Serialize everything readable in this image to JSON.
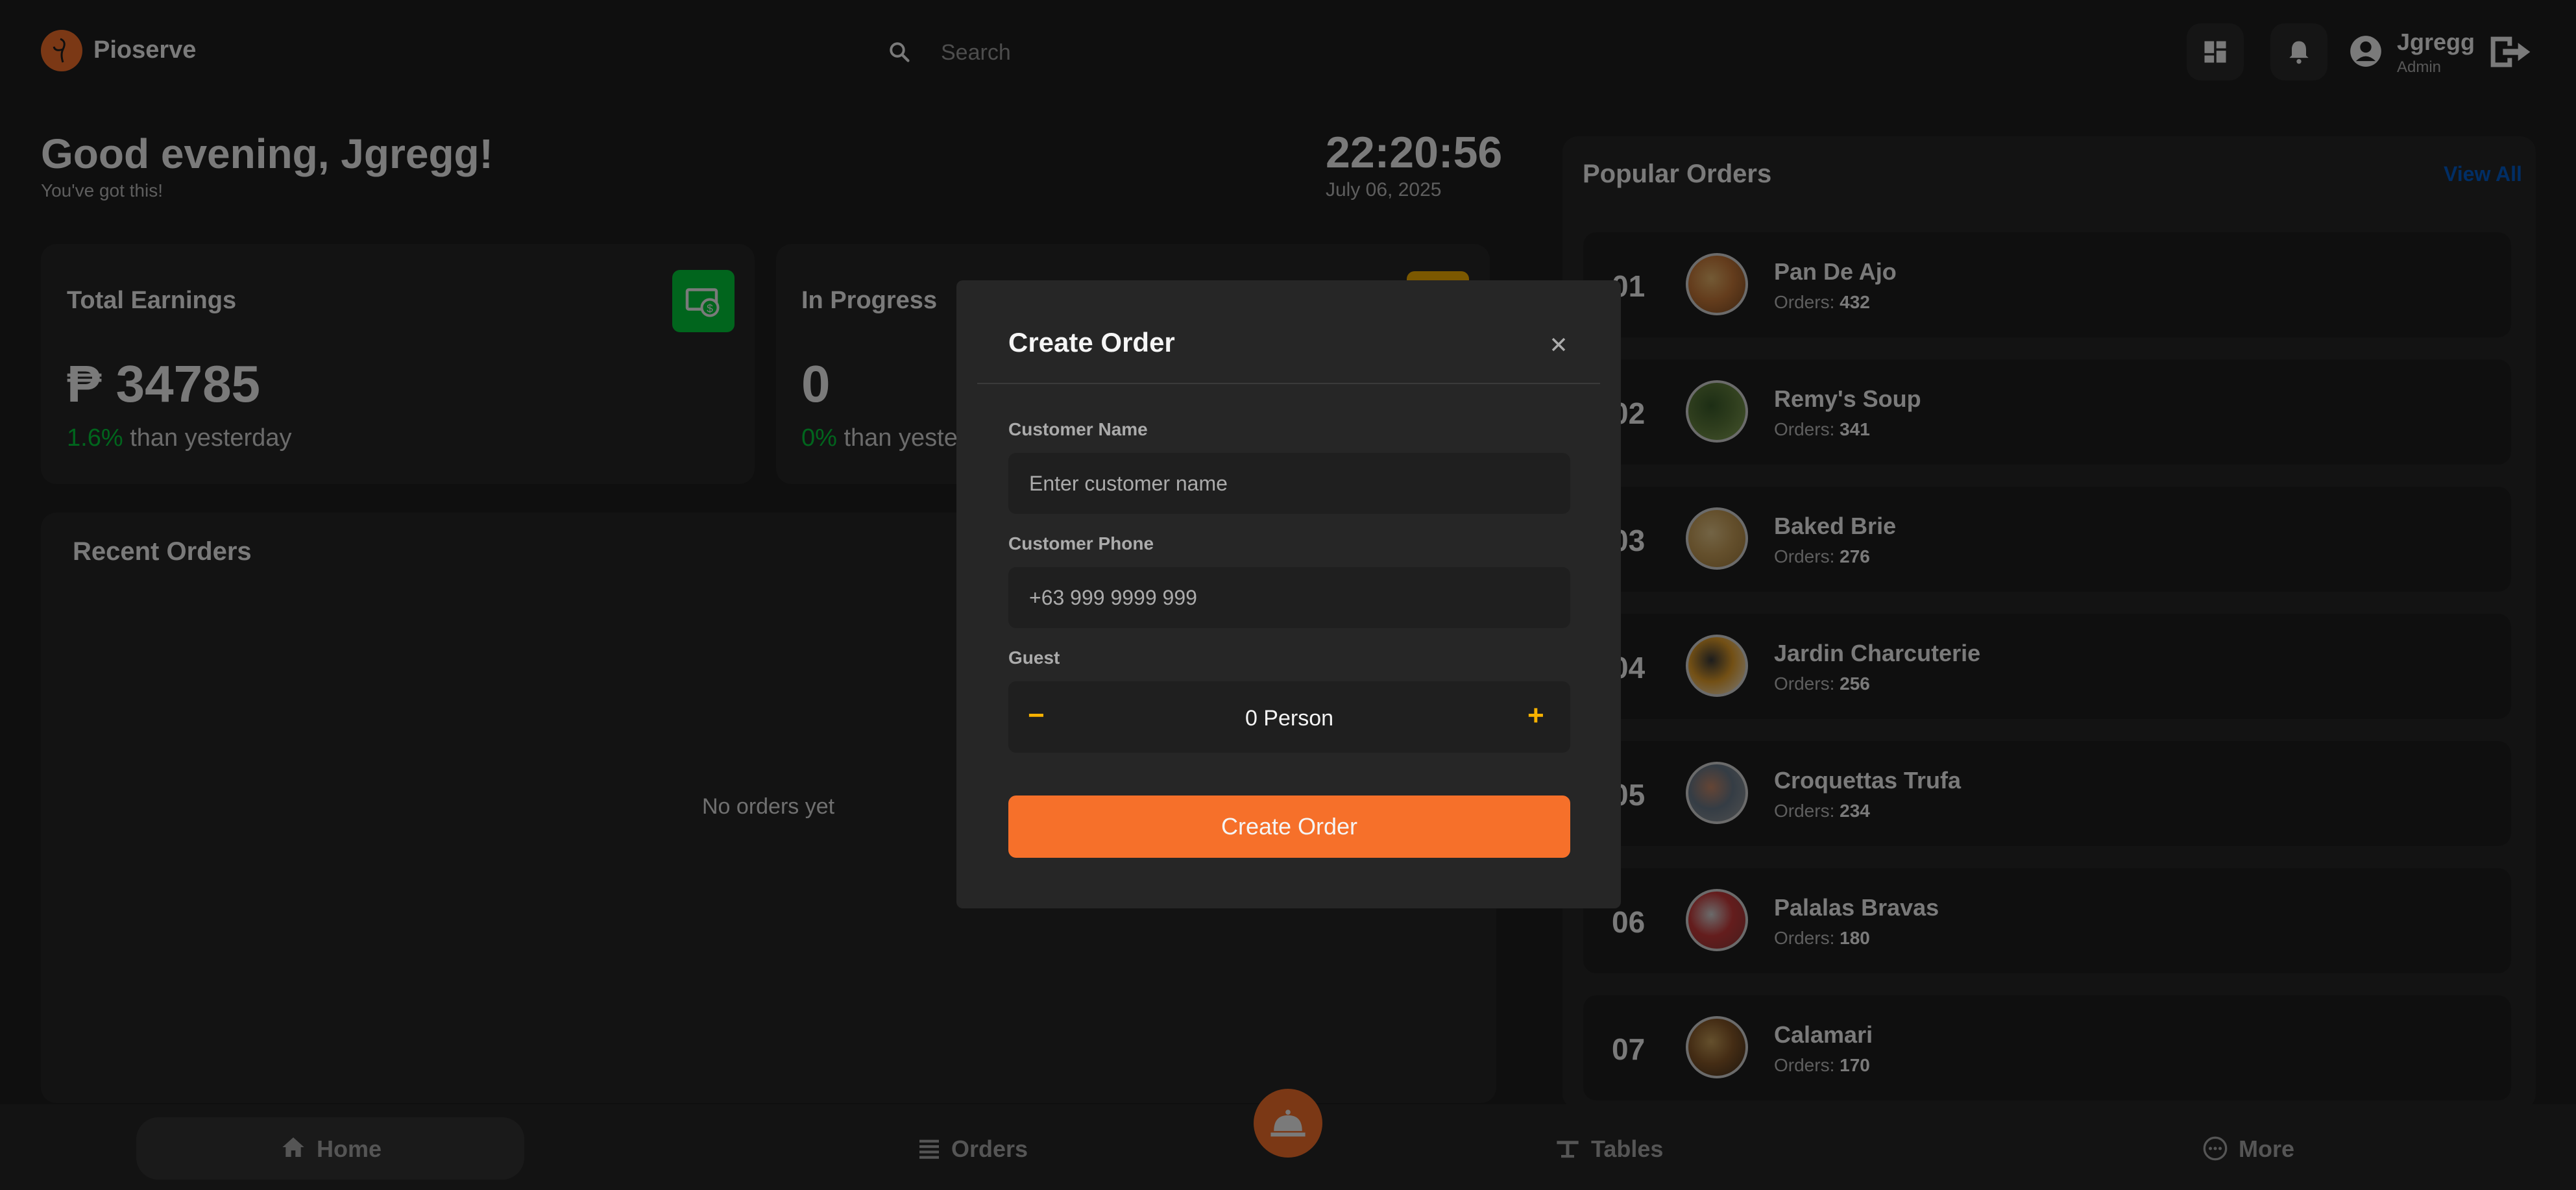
{
  "app": {
    "name": "Pioserve"
  },
  "header": {
    "search_placeholder": "Search",
    "user": {
      "name": "Jgregg",
      "role": "Admin"
    }
  },
  "greeting": {
    "title": "Good evening, Jgregg!",
    "subtitle": "You've got this!"
  },
  "clock": {
    "time": "22:20:56",
    "date": "July 06, 2025"
  },
  "stats": [
    {
      "title": "Total Earnings",
      "value": "₱ 34785",
      "delta": "1.6%",
      "delta_text": "than yesterday"
    },
    {
      "title": "In Progress",
      "value": "0",
      "delta": "0%",
      "delta_text": "than yeste"
    }
  ],
  "recent_orders": {
    "title": "Recent Orders",
    "empty_text": "No orders yet"
  },
  "popular": {
    "title": "Popular Orders",
    "view_all": "View All",
    "orders_label": "Orders:",
    "items": [
      {
        "num": "01",
        "name": "Pan De Ajo",
        "orders": "432"
      },
      {
        "num": "02",
        "name": "Remy's Soup",
        "orders": "341"
      },
      {
        "num": "03",
        "name": "Baked Brie",
        "orders": "276"
      },
      {
        "num": "04",
        "name": "Jardin Charcuterie",
        "orders": "256"
      },
      {
        "num": "05",
        "name": "Croquettas Trufa",
        "orders": "234"
      },
      {
        "num": "06",
        "name": "Palalas Bravas",
        "orders": "180"
      },
      {
        "num": "07",
        "name": "Calamari",
        "orders": "170"
      }
    ]
  },
  "nav": {
    "home": "Home",
    "orders": "Orders",
    "tables": "Tables",
    "more": "More"
  },
  "modal": {
    "title": "Create Order",
    "customer_name_label": "Customer Name",
    "customer_name_placeholder": "Enter customer name",
    "customer_phone_label": "Customer Phone",
    "customer_phone_placeholder": "+63 999 9999 999",
    "guest_label": "Guest",
    "guest_value": "0 Person",
    "minus": "−",
    "plus": "+",
    "submit_label": "Create Order"
  },
  "colors": {
    "accent": "#f6702a",
    "success": "#02ca3a",
    "warning": "#f6b100",
    "link": "#025cca",
    "background": "#1f1f1f"
  }
}
